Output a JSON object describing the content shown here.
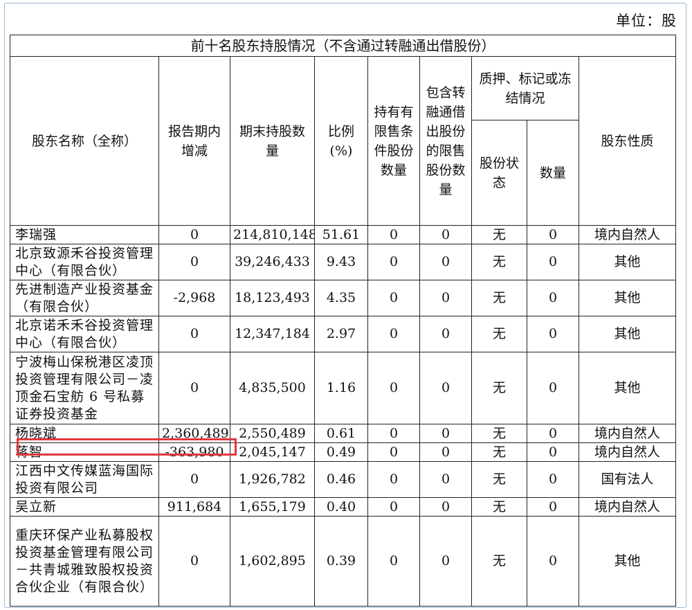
{
  "unit_label": "单位：股",
  "table_title": "前十名股东持股情况（不含通过转融通出借股份）",
  "headers": {
    "name": "股东名称（全称）",
    "change": "报告期内增减",
    "shares": "期末持股数量",
    "ratio": "比例(%)",
    "restricted": "持有有限售条件股份数量",
    "lent": "包含转融通借出股份的限售股份数量",
    "pledge_group": "质押、标记或冻结情况",
    "pledge_status": "股份状态",
    "pledge_qty": "数量",
    "nature": "股东性质"
  },
  "rows": [
    {
      "name": "李瑞强",
      "change": "0",
      "shares": "214,810,148",
      "ratio": "51.61",
      "restricted": "0",
      "lent": "0",
      "status": "无",
      "qty": "0",
      "nature": "境内自然人"
    },
    {
      "name": "北京致源禾谷投资管理中心（有限合伙）",
      "change": "0",
      "shares": "39,246,433",
      "ratio": "9.43",
      "restricted": "0",
      "lent": "0",
      "status": "无",
      "qty": "0",
      "nature": "其他"
    },
    {
      "name": "先进制造产业投资基金（有限合伙）",
      "change": "-2,968",
      "shares": "18,123,493",
      "ratio": "4.35",
      "restricted": "0",
      "lent": "0",
      "status": "无",
      "qty": "0",
      "nature": "其他"
    },
    {
      "name": "北京诺禾禾谷投资管理中心（有限合伙）",
      "change": "0",
      "shares": "12,347,184",
      "ratio": "2.97",
      "restricted": "0",
      "lent": "0",
      "status": "无",
      "qty": "0",
      "nature": "其他"
    },
    {
      "name": "宁波梅山保税港区凌顶投资管理有限公司－凌顶金石宝舫 6 号私募证券投资基金",
      "change": "0",
      "shares": "4,835,500",
      "ratio": "1.16",
      "restricted": "0",
      "lent": "0",
      "status": "无",
      "qty": "0",
      "nature": "其他"
    },
    {
      "name": "杨晓斌",
      "change": "2,360,489",
      "shares": "2,550,489",
      "ratio": "0.61",
      "restricted": "0",
      "lent": "0",
      "status": "无",
      "qty": "0",
      "nature": "境内自然人"
    },
    {
      "name": "蒋智",
      "change": "-363,980",
      "shares": "2,045,147",
      "ratio": "0.49",
      "restricted": "0",
      "lent": "0",
      "status": "无",
      "qty": "0",
      "nature": "境内自然人"
    },
    {
      "name": "江西中文传媒蓝海国际投资有限公司",
      "change": "0",
      "shares": "1,926,782",
      "ratio": "0.46",
      "restricted": "0",
      "lent": "0",
      "status": "无",
      "qty": "0",
      "nature": "国有法人"
    },
    {
      "name": "吴立新",
      "change": "911,684",
      "shares": "1,655,179",
      "ratio": "0.40",
      "restricted": "0",
      "lent": "0",
      "status": "无",
      "qty": "0",
      "nature": "境内自然人"
    },
    {
      "name": "重庆环保产业私募股权投资基金管理有限公司－共青城雅致股权投资合伙企业（有限合伙）",
      "change": "0",
      "shares": "1,602,895",
      "ratio": "0.39",
      "restricted": "0",
      "lent": "0",
      "status": "无",
      "qty": "0",
      "nature": "其他"
    }
  ],
  "highlight_color": "#e0383c"
}
